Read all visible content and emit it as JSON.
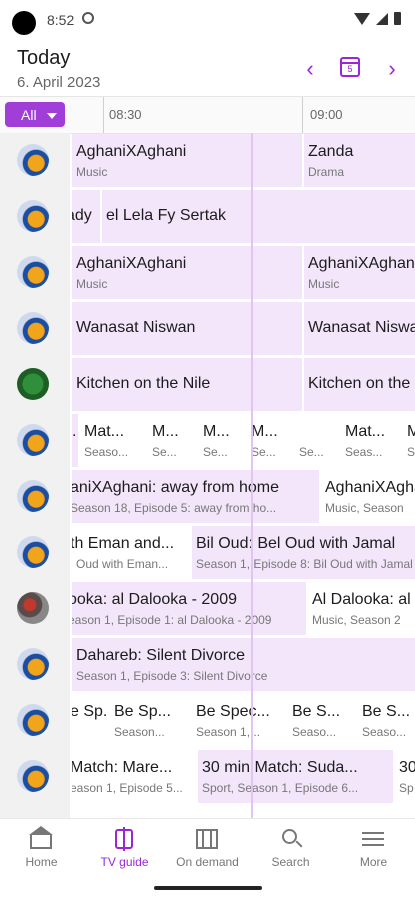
{
  "status": {
    "time": "8:52"
  },
  "header": {
    "title": "Today",
    "date": "6. April 2023",
    "calendar_day": "5"
  },
  "filter": {
    "label": "All"
  },
  "timeline": {
    "ticks": [
      "08:30",
      "09:00"
    ]
  },
  "rows": [
    {
      "logo": "channel-logo",
      "cells": [
        {
          "title": "AghaniXAghani",
          "sub": "Music"
        },
        {
          "title": "Zanda",
          "sub": "Drama"
        }
      ]
    },
    {
      "logo": "channel-logo",
      "cells": [
        {
          "title": "ady",
          "sub": ""
        },
        {
          "title": "el Lela Fy Sertak",
          "sub": ""
        }
      ]
    },
    {
      "logo": "channel-logo",
      "cells": [
        {
          "title": "AghaniXAghani",
          "sub": "Music"
        },
        {
          "title": "AghaniXAghani",
          "sub": "Music"
        }
      ]
    },
    {
      "logo": "channel-logo",
      "cells": [
        {
          "title": "Wanasat Niswan",
          "sub": ""
        },
        {
          "title": "Wanasat Niswan",
          "sub": ""
        }
      ]
    },
    {
      "logo": "channel-logo-green",
      "cells": [
        {
          "title": "Kitchen on the Nile",
          "sub": ""
        },
        {
          "title": "Kitchen on the Nile",
          "sub": ""
        }
      ]
    },
    {
      "logo": "channel-logo",
      "cells": [
        {
          "title": "...",
          "sub": ""
        },
        {
          "title": "Mat...",
          "sub": "Seaso..."
        },
        {
          "title": "M...",
          "sub": "Se..."
        },
        {
          "title": "M...",
          "sub": "Se..."
        },
        {
          "title": "M...",
          "sub": "Se..."
        },
        {
          "title": "",
          "sub": "Se..."
        },
        {
          "title": "Mat...",
          "sub": "Seas..."
        },
        {
          "title": "M",
          "sub": "S"
        }
      ]
    },
    {
      "logo": "channel-logo",
      "cells": [
        {
          "title": "aniXAghani: away from home",
          "sub": "Season 18, Episode 5: away from ho..."
        },
        {
          "title": "AghaniXAghani",
          "sub": "Music, Season"
        }
      ]
    },
    {
      "logo": "channel-logo",
      "cells": [
        {
          "title": "th Eman and...",
          "sub": "l Oud with Eman..."
        },
        {
          "title": "Bil Oud: Bel Oud with Jamal",
          "sub": "Season 1, Episode 8: Bil Oud with Jamal"
        }
      ]
    },
    {
      "logo": "channel-logo-photo",
      "cells": [
        {
          "title": "ooka: al Dalooka - 2009",
          "sub": "eason 1, Episode 1: al Dalooka - 2009"
        },
        {
          "title": "Al Dalooka: al",
          "sub": "Music, Season 2"
        }
      ]
    },
    {
      "logo": "channel-logo",
      "cells": [
        {
          "title": "Dahareb: Silent Divorce",
          "sub": "Season 1, Episode 3: Silent Divorce"
        }
      ]
    },
    {
      "logo": "channel-logo",
      "cells": [
        {
          "title": "e Sp...",
          "sub": ""
        },
        {
          "title": "Be Sp...",
          "sub": "Season..."
        },
        {
          "title": "Be Spec...",
          "sub": "Season 1,..."
        },
        {
          "title": "Be S...",
          "sub": "Seaso..."
        },
        {
          "title": "Be S...",
          "sub": "Seaso..."
        }
      ]
    },
    {
      "logo": "channel-logo",
      "cells": [
        {
          "title": "Match: Mare...",
          "sub": "eason 1, Episode 5..."
        },
        {
          "title": "30 min Match: Suda...",
          "sub": "Sport, Season 1, Episode 6..."
        },
        {
          "title": "30",
          "sub": "Sp"
        }
      ]
    }
  ],
  "nav": [
    {
      "label": "Home",
      "icon": "home-icon",
      "active": false
    },
    {
      "label": "TV guide",
      "icon": "tv-guide-icon",
      "active": true
    },
    {
      "label": "On demand",
      "icon": "film-icon",
      "active": false
    },
    {
      "label": "Search",
      "icon": "search-icon",
      "active": false
    },
    {
      "label": "More",
      "icon": "menu-icon",
      "active": false
    }
  ],
  "colors": {
    "accent": "#9b26d6",
    "program_bg": "#f3e6fb",
    "logo_column": "#f1f1f1"
  }
}
